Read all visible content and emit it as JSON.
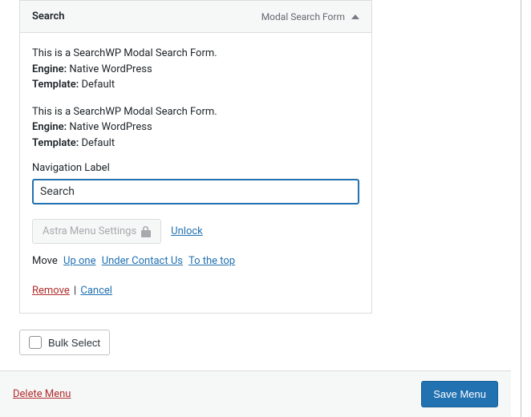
{
  "panel": {
    "title": "Search",
    "type_label": "Modal Search Form"
  },
  "blocks": [
    {
      "intro": "This is a SearchWP Modal Search Form.",
      "engine_label": "Engine:",
      "engine_value": " Native WordPress",
      "template_label": "Template:",
      "template_value": " Default"
    },
    {
      "intro": "This is a SearchWP Modal Search Form.",
      "engine_label": "Engine:",
      "engine_value": " Native WordPress",
      "template_label": "Template:",
      "template_value": " Default"
    }
  ],
  "nav_label": {
    "label": "Navigation Label",
    "value": "Search"
  },
  "astra": {
    "button": "Astra Menu Settings",
    "unlock": "Unlock"
  },
  "move": {
    "label": "Move",
    "up_one": "Up one",
    "under": "Under Contact Us",
    "top": "To the top"
  },
  "actions": {
    "remove": "Remove",
    "sep": " | ",
    "cancel": "Cancel"
  },
  "bulk": {
    "label": "Bulk Select"
  },
  "footer": {
    "delete": "Delete Menu",
    "save": "Save Menu"
  }
}
